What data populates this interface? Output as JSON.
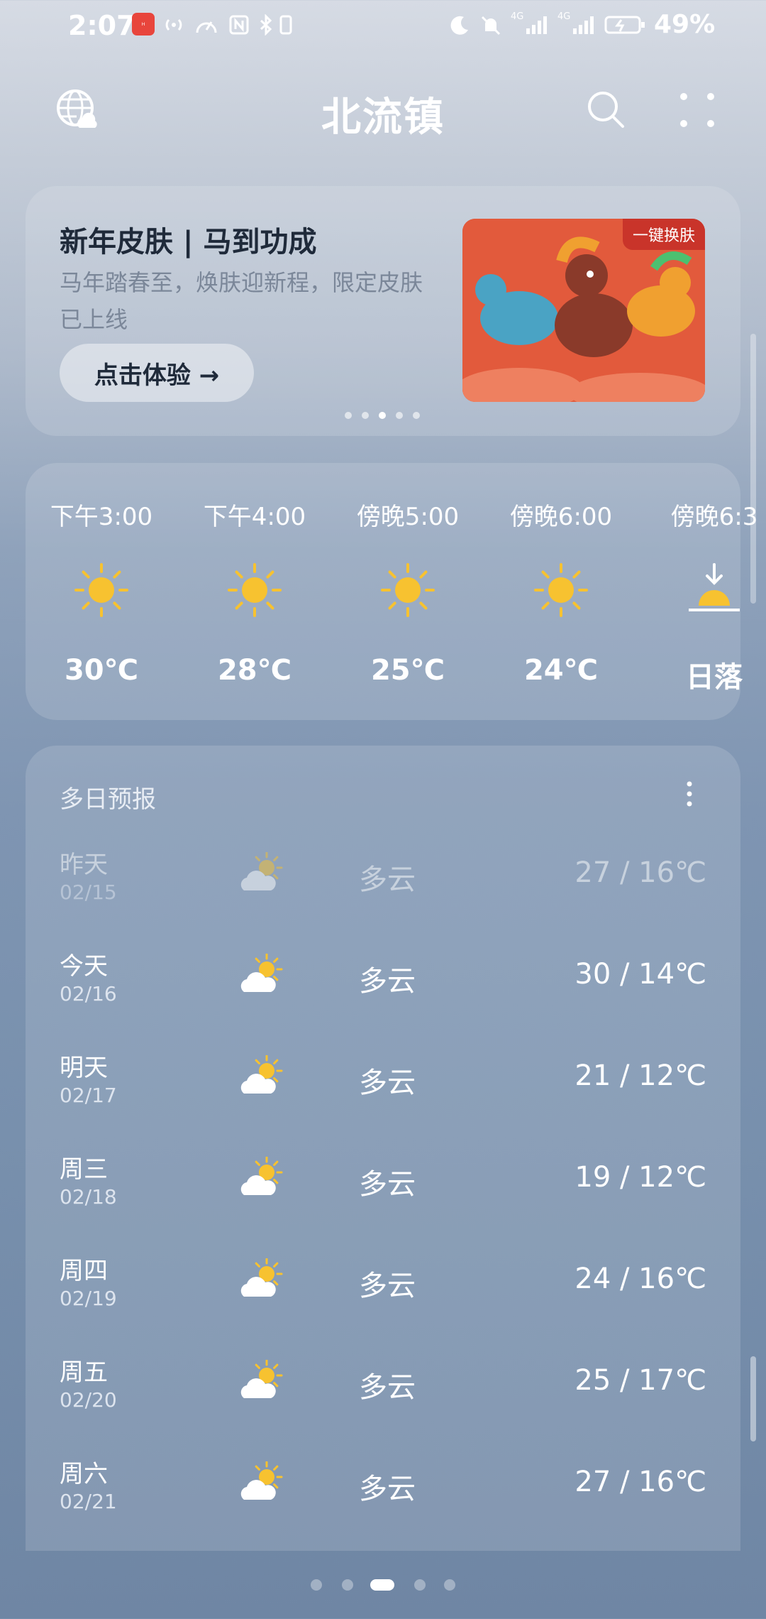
{
  "status_bar": {
    "time": "2:07",
    "battery": "49%",
    "signal_labels": [
      "4G",
      "4G"
    ]
  },
  "header": {
    "title": "北流镇",
    "left_icon": "globe-cloud-icon",
    "search_icon": "search-icon",
    "menu_icon": "more-icon"
  },
  "promo": {
    "title": "新年皮肤 | 马到功成",
    "subtitle": "马年踏春至，焕肤迎新程，限定皮肤已上线",
    "button_label": "点击体验 →",
    "tag": "一键换肤",
    "image_icon": "horse-skin-illustration",
    "carousel_dots": 5,
    "active_dot": 2
  },
  "hourly": [
    {
      "time": "下午3:00",
      "icon": "sun-icon",
      "value": "30℃"
    },
    {
      "time": "下午4:00",
      "icon": "sun-icon",
      "value": "28℃"
    },
    {
      "time": "傍晚5:00",
      "icon": "sun-icon",
      "value": "25℃"
    },
    {
      "time": "傍晚6:00",
      "icon": "sun-icon",
      "value": "24℃"
    },
    {
      "time": "傍晚6:3",
      "icon": "sunset-icon",
      "value": "日落"
    }
  ],
  "forecast": {
    "title": "多日预报",
    "days": [
      {
        "day": "昨天",
        "date": "02/15",
        "desc": "多云",
        "temp": "27 / 16℃",
        "icon": "partly-cloudy-icon"
      },
      {
        "day": "今天",
        "date": "02/16",
        "desc": "多云",
        "temp": "30 / 14℃",
        "icon": "partly-cloudy-icon"
      },
      {
        "day": "明天",
        "date": "02/17",
        "desc": "多云",
        "temp": "21 / 12℃",
        "icon": "partly-cloudy-icon"
      },
      {
        "day": "周三",
        "date": "02/18",
        "desc": "多云",
        "temp": "19 / 12℃",
        "icon": "partly-cloudy-icon"
      },
      {
        "day": "周四",
        "date": "02/19",
        "desc": "多云",
        "temp": "24 / 16℃",
        "icon": "partly-cloudy-icon"
      },
      {
        "day": "周五",
        "date": "02/20",
        "desc": "多云",
        "temp": "25 / 17℃",
        "icon": "partly-cloudy-icon"
      },
      {
        "day": "周六",
        "date": "02/21",
        "desc": "多云",
        "temp": "27 / 16℃",
        "icon": "partly-cloudy-icon"
      }
    ]
  },
  "page_indicator": {
    "count": 5,
    "active": 2
  },
  "colors": {
    "sun": "#f7c230",
    "promo_bg": "#e25a3c",
    "accent_dark": "#1f2a3a"
  }
}
